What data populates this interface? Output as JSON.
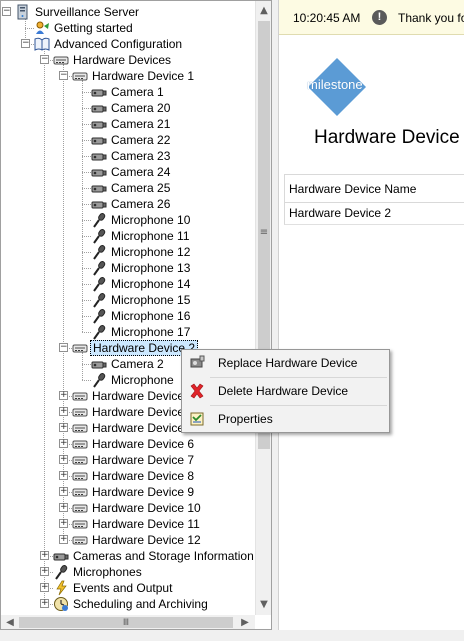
{
  "tree": {
    "nodes": [
      {
        "label": "Surveillance Server",
        "level": 0,
        "icon": "server-icon",
        "expander": "minus",
        "name": "tree-surveillance-server"
      },
      {
        "label": "Getting started",
        "level": 1,
        "icon": "getting-started-icon",
        "expander": "none",
        "name": "tree-getting-started"
      },
      {
        "label": "Advanced Configuration",
        "level": 1,
        "icon": "book-icon",
        "expander": "minus",
        "name": "tree-advanced-configuration"
      },
      {
        "label": "Hardware Devices",
        "level": 2,
        "icon": "hardware-device-icon",
        "expander": "minus",
        "name": "tree-hardware-devices"
      },
      {
        "label": "Hardware Device 1",
        "level": 3,
        "icon": "hardware-device-icon",
        "expander": "minus",
        "name": "tree-hardware-device-1"
      },
      {
        "label": "Camera 1",
        "level": 4,
        "icon": "camera-icon",
        "expander": "none",
        "name": "tree-camera-1"
      },
      {
        "label": "Camera 20",
        "level": 4,
        "icon": "camera-icon",
        "expander": "none",
        "name": "tree-camera-20"
      },
      {
        "label": "Camera 21",
        "level": 4,
        "icon": "camera-icon",
        "expander": "none",
        "name": "tree-camera-21"
      },
      {
        "label": "Camera 22",
        "level": 4,
        "icon": "camera-icon",
        "expander": "none",
        "name": "tree-camera-22"
      },
      {
        "label": "Camera 23",
        "level": 4,
        "icon": "camera-icon",
        "expander": "none",
        "name": "tree-camera-23"
      },
      {
        "label": "Camera 24",
        "level": 4,
        "icon": "camera-icon",
        "expander": "none",
        "name": "tree-camera-24"
      },
      {
        "label": "Camera 25",
        "level": 4,
        "icon": "camera-icon",
        "expander": "none",
        "name": "tree-camera-25"
      },
      {
        "label": "Camera 26",
        "level": 4,
        "icon": "camera-icon",
        "expander": "none",
        "name": "tree-camera-26"
      },
      {
        "label": "Microphone 10",
        "level": 4,
        "icon": "microphone-icon",
        "expander": "none",
        "name": "tree-microphone-10"
      },
      {
        "label": "Microphone 11",
        "level": 4,
        "icon": "microphone-icon",
        "expander": "none",
        "name": "tree-microphone-11"
      },
      {
        "label": "Microphone 12",
        "level": 4,
        "icon": "microphone-icon",
        "expander": "none",
        "name": "tree-microphone-12"
      },
      {
        "label": "Microphone 13",
        "level": 4,
        "icon": "microphone-icon",
        "expander": "none",
        "name": "tree-microphone-13"
      },
      {
        "label": "Microphone 14",
        "level": 4,
        "icon": "microphone-icon",
        "expander": "none",
        "name": "tree-microphone-14"
      },
      {
        "label": "Microphone 15",
        "level": 4,
        "icon": "microphone-icon",
        "expander": "none",
        "name": "tree-microphone-15"
      },
      {
        "label": "Microphone 16",
        "level": 4,
        "icon": "microphone-icon",
        "expander": "none",
        "name": "tree-microphone-16"
      },
      {
        "label": "Microphone 17",
        "level": 4,
        "icon": "microphone-icon",
        "expander": "none",
        "name": "tree-microphone-17"
      },
      {
        "label": "Hardware Device 2",
        "level": 3,
        "icon": "hardware-device-icon",
        "expander": "minus",
        "name": "tree-hardware-device-2",
        "selected": true
      },
      {
        "label": "Camera 2",
        "level": 4,
        "icon": "camera-icon",
        "expander": "none",
        "name": "tree-camera-2"
      },
      {
        "label": "Microphone",
        "level": 4,
        "icon": "microphone-icon",
        "expander": "none",
        "name": "tree-microphone-partial"
      },
      {
        "label": "Hardware Device",
        "level": 3,
        "icon": "hardware-device-icon",
        "expander": "plus",
        "name": "tree-hardware-device-3"
      },
      {
        "label": "Hardware Device",
        "level": 3,
        "icon": "hardware-device-icon",
        "expander": "plus",
        "name": "tree-hardware-device-4"
      },
      {
        "label": "Hardware Device",
        "level": 3,
        "icon": "hardware-device-icon",
        "expander": "plus",
        "name": "tree-hardware-device-5"
      },
      {
        "label": "Hardware Device 6",
        "level": 3,
        "icon": "hardware-device-icon",
        "expander": "plus",
        "name": "tree-hardware-device-6"
      },
      {
        "label": "Hardware Device 7",
        "level": 3,
        "icon": "hardware-device-icon",
        "expander": "plus",
        "name": "tree-hardware-device-7"
      },
      {
        "label": "Hardware Device 8",
        "level": 3,
        "icon": "hardware-device-icon",
        "expander": "plus",
        "name": "tree-hardware-device-8"
      },
      {
        "label": "Hardware Device 9",
        "level": 3,
        "icon": "hardware-device-icon",
        "expander": "plus",
        "name": "tree-hardware-device-9"
      },
      {
        "label": "Hardware Device 10",
        "level": 3,
        "icon": "hardware-device-icon",
        "expander": "plus",
        "name": "tree-hardware-device-10"
      },
      {
        "label": "Hardware Device 11",
        "level": 3,
        "icon": "hardware-device-icon",
        "expander": "plus",
        "name": "tree-hardware-device-11"
      },
      {
        "label": "Hardware Device 12",
        "level": 3,
        "icon": "hardware-device-icon",
        "expander": "plus",
        "name": "tree-hardware-device-12"
      },
      {
        "label": "Cameras and Storage Information",
        "level": 2,
        "icon": "camera-icon",
        "expander": "plus",
        "name": "tree-cameras-and-storage"
      },
      {
        "label": "Microphones",
        "level": 2,
        "icon": "microphone-icon",
        "expander": "plus",
        "name": "tree-microphones"
      },
      {
        "label": "Events and Output",
        "level": 2,
        "icon": "events-icon",
        "expander": "plus",
        "name": "tree-events-and-output"
      },
      {
        "label": "Scheduling and Archiving",
        "level": 2,
        "icon": "scheduling-icon",
        "expander": "plus",
        "name": "tree-scheduling-and-archiving"
      }
    ]
  },
  "scrollbars": {
    "up_arrow": "▲",
    "down_arrow": "▼",
    "grip": "≡",
    "left_arrow": "◀",
    "right_arrow": "▶",
    "h_grip": "Ⅲ"
  },
  "notification": {
    "time": "10:20:45 AM",
    "message": "Thank you for",
    "icon": "alert-icon"
  },
  "logo": {
    "text": "milestone",
    "color": "#5b9bd5"
  },
  "main": {
    "title": "Hardware Device",
    "table_header": "Hardware Device Name",
    "table_value": "Hardware Device 2"
  },
  "context_menu": {
    "items": [
      {
        "label": "Replace Hardware Device",
        "icon": "replace-hardware-icon",
        "name": "menu-replace-hardware-device"
      },
      {
        "label": "Delete Hardware Device",
        "icon": "delete-icon",
        "name": "menu-delete-hardware-device"
      },
      {
        "label": "Properties",
        "icon": "properties-icon",
        "name": "menu-properties"
      }
    ]
  }
}
